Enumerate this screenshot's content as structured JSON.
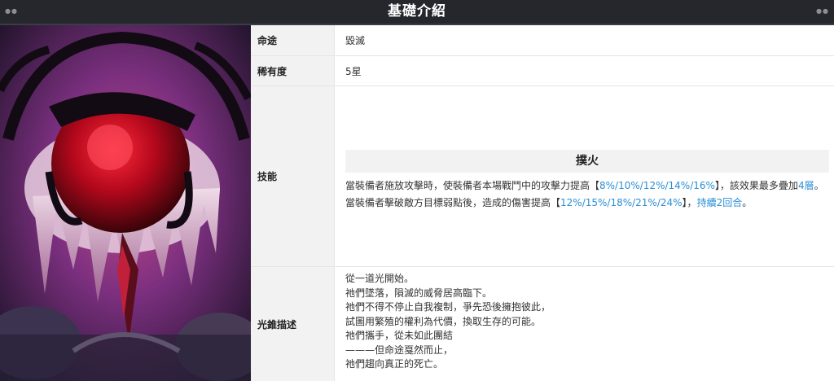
{
  "header": {
    "title": "基礎介紹"
  },
  "artwork": {
    "alt": "光錐插圖",
    "icon": "cone-artwork"
  },
  "rows": {
    "path": {
      "label": "命途",
      "value": "毀滅"
    },
    "rarity": {
      "label": "稀有度",
      "value": "5星"
    },
    "skill": {
      "label": "技能",
      "name": "撲火",
      "desc": {
        "p1": "當裝備者施放攻擊時，使裝備者本場戰鬥中的攻擊力提高【",
        "v1": "8%/10%/12%/14%/16%",
        "p2": "】，該效果最多疊加",
        "v2": "4層",
        "p3": "。當裝備者擊破敵方目標弱點後，造成的傷害提高【",
        "v3": "12%/15%/18%/21%/24%",
        "p4": "】，",
        "v4": "持續2回合",
        "p5": "。"
      }
    },
    "lore": {
      "label": "光錐描述",
      "lines": [
        "從一道光開始。",
        "祂們墜落，隕滅的威脅居高臨下。",
        "祂們不得不停止自我複制，爭先恐後擁抱彼此，",
        "試圖用繁殖的權利為代價，換取生存的可能。",
        "祂們攜手，從未如此團結",
        "———但命途戛然而止，",
        "祂們趨向真正的死亡。"
      ]
    }
  },
  "colors": {
    "highlight": "#2b8fd6",
    "header_bg": "#25272d"
  }
}
